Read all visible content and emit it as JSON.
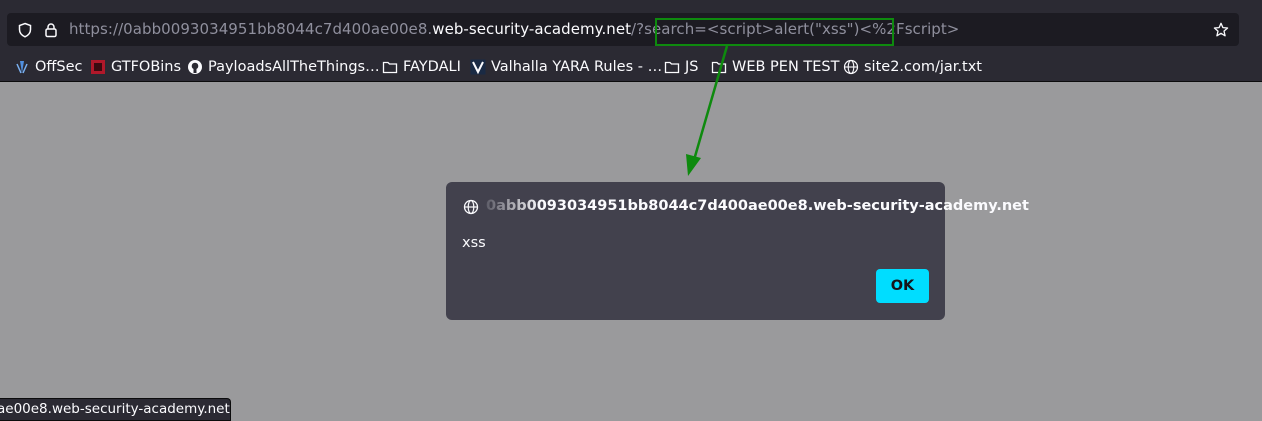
{
  "browser": {
    "url_prefix": "https://0abb0093034951bb8044c7d400ae00e8.",
    "url_domain": "web-security-academy.net",
    "url_path": "/?search=",
    "url_query": "<script>alert(\"xss\")<%2Fscript>"
  },
  "bookmarks": [
    {
      "label": "OffSec",
      "icon": "offsec-icon"
    },
    {
      "label": "GTFOBins",
      "icon": "gtfobins-icon"
    },
    {
      "label": "PayloadsAllTheThings…",
      "icon": "github-icon"
    },
    {
      "label": "FAYDALI",
      "icon": "folder-icon"
    },
    {
      "label": "Valhalla YARA Rules - …",
      "icon": "valhalla-icon"
    },
    {
      "label": "JS",
      "icon": "folder-icon"
    },
    {
      "label": "WEB PEN TEST",
      "icon": "folder-icon"
    },
    {
      "label": "site2.com/jar.txt",
      "icon": "globe-icon"
    }
  ],
  "dialog": {
    "origin": "0abb0093034951bb8044c7d400ae00e8.web-security-academy.net",
    "message": "xss",
    "ok_label": "OK"
  },
  "status_bar": {
    "text": "ae00e8.web-security-academy.net"
  },
  "colors": {
    "highlight": "#0e8a0e",
    "ok_button": "#00ddff",
    "dialog_bg": "#42414d",
    "page_overlay": "#9a9a9c"
  }
}
